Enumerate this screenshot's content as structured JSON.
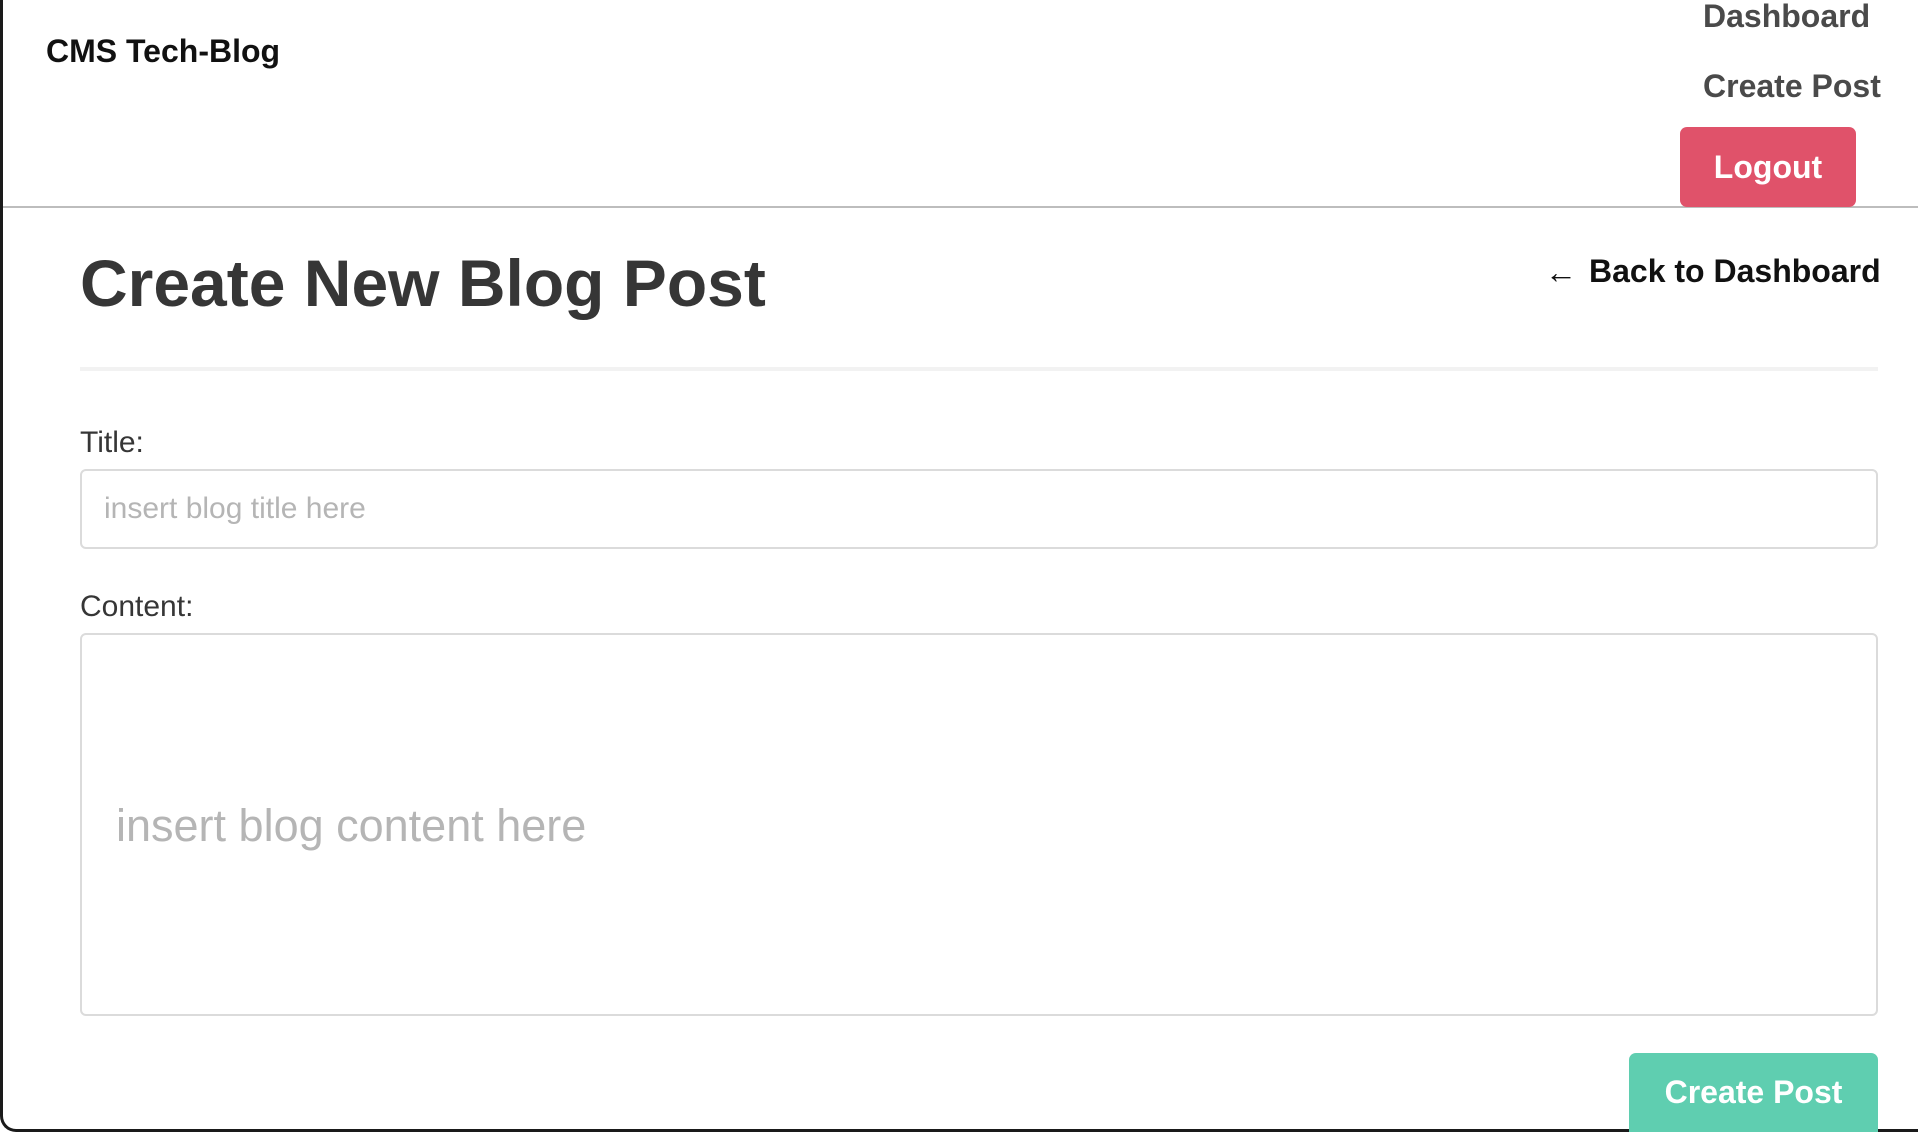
{
  "navbar": {
    "brand": "CMS Tech-Blog",
    "links": {
      "dashboard": "Dashboard",
      "create_post": "Create Post"
    },
    "logout_label": "Logout"
  },
  "page": {
    "title": "Create New Blog Post",
    "back_arrow": "←",
    "back_label": "Back to Dashboard"
  },
  "form": {
    "title_label": "Title:",
    "title_placeholder": "insert blog title here",
    "title_value": "",
    "content_label": "Content:",
    "content_placeholder": "insert blog content here",
    "content_value": "",
    "submit_label": "Create Post"
  },
  "colors": {
    "logout_button": "#e0526a",
    "submit_button": "#5fceb0",
    "heading_text": "#363636",
    "placeholder_text": "#b5b5b5"
  },
  "icons": {
    "back": "left-arrow-icon"
  }
}
